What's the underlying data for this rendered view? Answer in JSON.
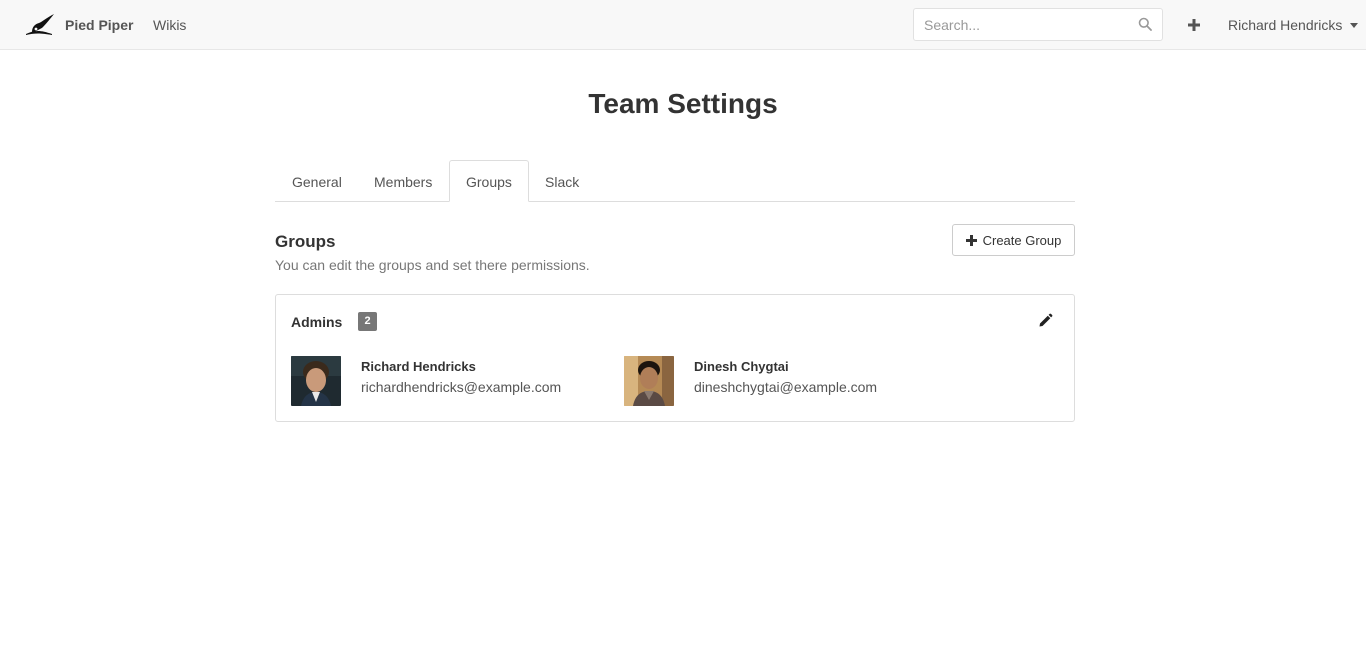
{
  "navbar": {
    "brand_name": "Pied Piper",
    "wikis_label": "Wikis",
    "search_placeholder": "Search...",
    "user_name": "Richard Hendricks"
  },
  "page": {
    "title": "Team Settings"
  },
  "tabs": [
    {
      "label": "General",
      "active": false
    },
    {
      "label": "Members",
      "active": false
    },
    {
      "label": "Groups",
      "active": true
    },
    {
      "label": "Slack",
      "active": false
    }
  ],
  "groups_section": {
    "heading": "Groups",
    "description": "You can edit the groups and set there permissions.",
    "create_button_label": "Create Group"
  },
  "groups": [
    {
      "name": "Admins",
      "member_count": "2",
      "members": [
        {
          "name": "Richard Hendricks",
          "email": "richardhendricks@example.com"
        },
        {
          "name": "Dinesh Chygtai",
          "email": "dineshchygtai@example.com"
        }
      ]
    }
  ],
  "icons": {
    "logo": "pied-piper-logo",
    "search": "search-icon",
    "plus": "plus-icon",
    "caret": "caret-down-icon",
    "edit": "pencil-icon"
  },
  "colors": {
    "navbar_bg": "#f8f8f8",
    "badge_bg": "#777777",
    "border": "#dddddd"
  }
}
